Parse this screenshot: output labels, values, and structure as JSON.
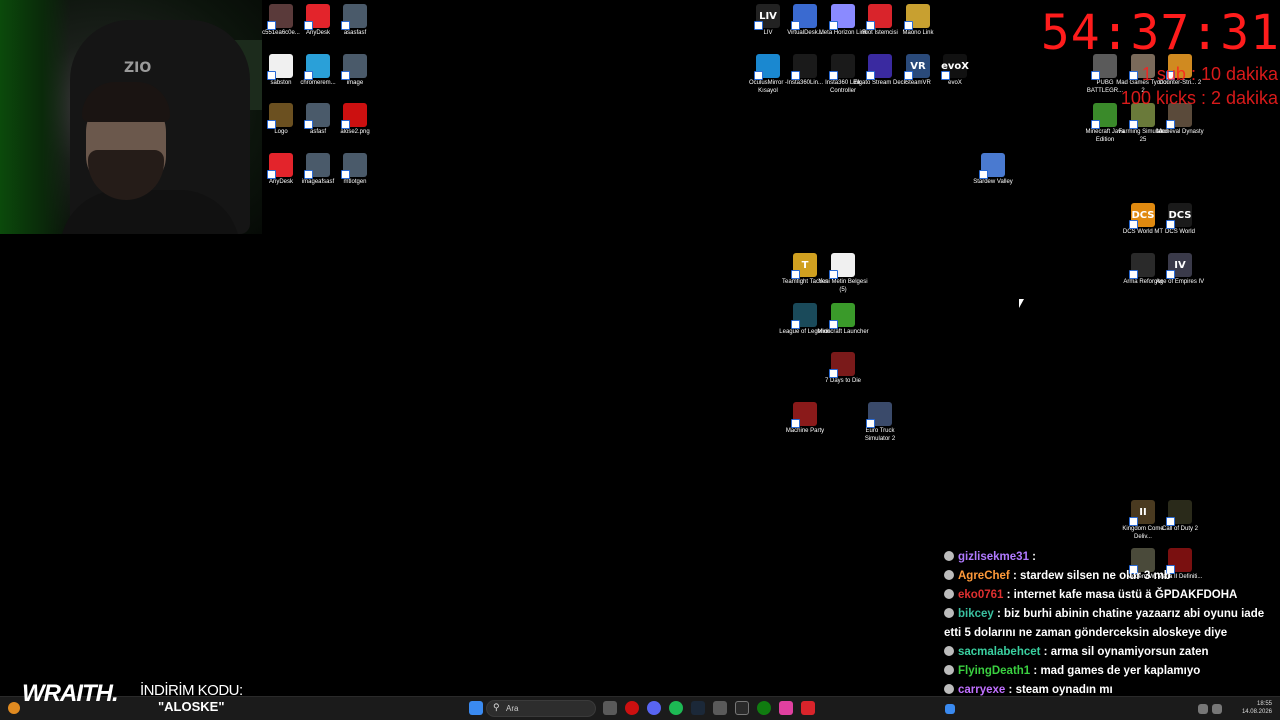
{
  "timer": "54:37:31",
  "goals": [
    "1 sub : 10 dakika",
    "100 kicks : 2 dakika"
  ],
  "desktop_icons": [
    {
      "label": "c551ea6c0e...",
      "color": "#5a3a3a"
    },
    {
      "label": "AnyDesk",
      "color": "#e3242b"
    },
    {
      "label": "asasfasf",
      "color": "#4a5a6a"
    },
    {
      "label": "sabston",
      "color": "#f0f0f0"
    },
    {
      "label": "chromerem...",
      "color": "#2aa0d8"
    },
    {
      "label": "image",
      "color": "#4a5a6a"
    },
    {
      "label": "Logo",
      "color": "#6b5020"
    },
    {
      "label": "asfasf",
      "color": "#4a5a6a"
    },
    {
      "label": "alose2.png",
      "color": "#cc1010"
    },
    {
      "label": "AnyDesk",
      "color": "#e3242b"
    },
    {
      "label": "imageafsasf",
      "color": "#4a5a6a"
    },
    {
      "label": "mtlotgen",
      "color": "#4a5a6a"
    },
    {
      "label": "LIV",
      "color": "#222222",
      "glyph": "LIV"
    },
    {
      "label": "VirtualDesk...",
      "color": "#3a6ad0"
    },
    {
      "label": "Meta Horizon Link",
      "color": "#8a8aff"
    },
    {
      "label": "Riot İstemcisi",
      "color": "#d9242b"
    },
    {
      "label": "Maono Link",
      "color": "#c8a030"
    },
    {
      "label": "OculusMirror - Kısayol",
      "color": "#1a88d0"
    },
    {
      "label": "Insta360Lin...",
      "color": "#1a1a1a"
    },
    {
      "label": "Insta360 Link Controller",
      "color": "#1a1a1a"
    },
    {
      "label": "Elgato Stream Deck",
      "color": "#3a2aa0"
    },
    {
      "label": "SteamVR",
      "color": "#2a4a7a",
      "glyph": "VR"
    },
    {
      "label": "evoX",
      "color": "#111111",
      "glyph": "evoX"
    },
    {
      "label": "PUBG BATTLEGR...",
      "color": "#5a5a5a"
    },
    {
      "label": "Mad Games Tycoon 2",
      "color": "#7a6a5a"
    },
    {
      "label": "Counter-Stri... 2",
      "color": "#d08a20"
    },
    {
      "label": "Minecraft Java Edition",
      "color": "#3a8a2a"
    },
    {
      "label": "Farming Simulator 25",
      "color": "#6a7a3a"
    },
    {
      "label": "Medieval Dynasty",
      "color": "#5a4a3a"
    },
    {
      "label": "Stardew Valley",
      "color": "#4a7ad0"
    },
    {
      "label": "DCS World MT",
      "color": "#e08a10",
      "glyph": "DCS"
    },
    {
      "label": "DCS World",
      "color": "#1a1a1a",
      "glyph": "DCS"
    },
    {
      "label": "Arma Reforger",
      "color": "#2a2a2a"
    },
    {
      "label": "Age of Empires IV",
      "color": "#3a3a4a",
      "glyph": "IV"
    },
    {
      "label": "Teamfight Tactics",
      "color": "#d0a020",
      "glyph": "T"
    },
    {
      "label": "Yeni Metin Belgesi (5)",
      "color": "#f0f0f0"
    },
    {
      "label": "League of Legends",
      "color": "#1a4a5a"
    },
    {
      "label": "Minecraft Launcher",
      "color": "#3a9a2a"
    },
    {
      "label": "7 Days to Die",
      "color": "#7a1a1a"
    },
    {
      "label": "Machine Party",
      "color": "#8a1a1a"
    },
    {
      "label": "Euro Truck Simulator 2",
      "color": "#3a4a6a"
    },
    {
      "label": "Kingdom Come Deliv...",
      "color": "#4a3a20",
      "glyph": "II"
    },
    {
      "label": "Call of Duty 2",
      "color": "#2a2a1a"
    },
    {
      "label": "Modern W...",
      "color": "#4a4a3a"
    },
    {
      "label": "Mafia II Definiti...",
      "color": "#7a1010"
    }
  ],
  "chat": [
    {
      "user": "gizlisekme31",
      "color": "#b07aff",
      "text": ""
    },
    {
      "user": "AgreChef",
      "color": "#ff9a3a",
      "text": "stardew silsen ne olur 3 mb"
    },
    {
      "user": "eko0761",
      "color": "#e03030",
      "text": "internet kafe masa üstü ä ĞPDAKFDOHA"
    },
    {
      "user": "bikcey",
      "color": "#3ac0a0",
      "text": "biz burhi abinin chatine yazaarız abi oyunu iade etti 5 dolarını ne zaman gönderceksin aloskeye diye"
    },
    {
      "user": "sacmalabehcet",
      "color": "#3ad0a0",
      "text": "arma sil oynamiyorsun zaten"
    },
    {
      "user": "FlyingDeath1",
      "color": "#3ad040",
      "text": "mad games de yer kaplamıyo"
    },
    {
      "user": "carryexe",
      "color": "#c070ff",
      "text": "steam oynadın mı"
    }
  ],
  "overlay": {
    "brand": "WRAITH.",
    "promo_label": "İNDİRİM KODU:",
    "promo_code": "\"ALOSKE\""
  },
  "taskbar": {
    "search_placeholder": "Ara",
    "time": "18:55",
    "date": "14.08.2026"
  },
  "webcam": {
    "chair_logo": "ZIO"
  }
}
